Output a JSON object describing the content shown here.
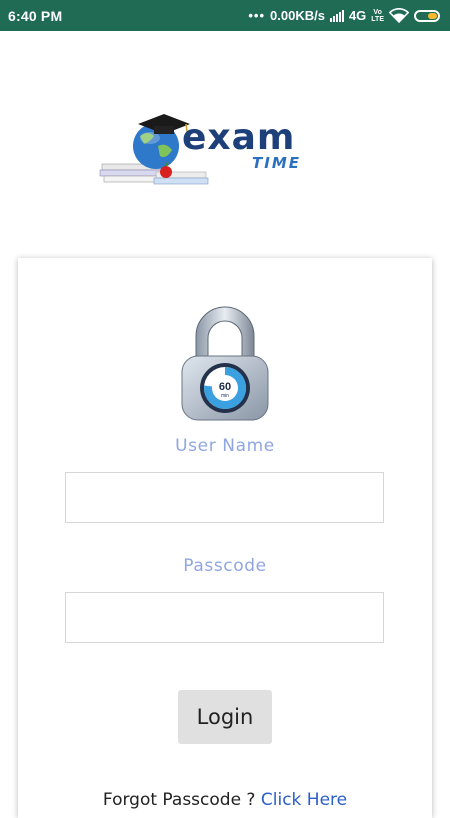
{
  "status_bar": {
    "time": "6:40 PM",
    "network_speed": "0.00KB/s",
    "network_type": "4G",
    "volte_top": "Vo",
    "volte_bottom": "LTE",
    "colors": {
      "background": "#1f6b54",
      "battery_fill": "#f5b82e"
    },
    "icons": [
      "more-dots-icon",
      "signal-icon",
      "volte-icon",
      "wifi-icon",
      "battery-icon"
    ]
  },
  "logo": {
    "word_top": "exam",
    "word_bottom": "TIME",
    "colors": {
      "exam": "#1d3f7a",
      "time": "#2b70c0"
    }
  },
  "login_card": {
    "lock_icon_text": "60",
    "lock_icon_subtext": "min",
    "username": {
      "label": "User Name",
      "value": "",
      "placeholder": ""
    },
    "passcode": {
      "label": "Passcode",
      "value": "",
      "placeholder": ""
    },
    "login_label": "Login",
    "forgot_text": "Forgot Passcode ? ",
    "forgot_link": "Click Here",
    "colors": {
      "label": "#8fa6e0",
      "button": "#e0e0e0",
      "link": "#2b5fc7"
    }
  }
}
